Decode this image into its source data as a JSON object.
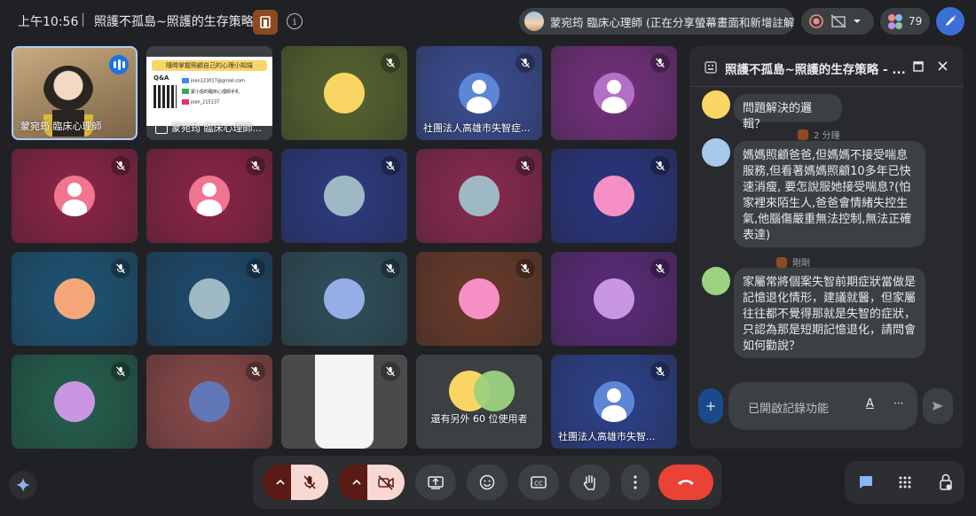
{
  "topbar": {
    "time": "上午10:56",
    "separator": "|",
    "meeting_title": "照護不孤島~照護的生存策略",
    "info_label": "i",
    "presenter_text": "蒙宛筠 臨床心理師 (正在分享螢幕畫面和新增註解)",
    "participant_count": "79"
  },
  "tiles": [
    {
      "name": "蒙宛筠 臨床心理師",
      "kind": "video"
    },
    {
      "name": "蒙宛筠 臨床心理師...",
      "kind": "screen"
    },
    {
      "name": "",
      "kind": "avatar",
      "bg": "#56652f",
      "avatar": "#fbd564"
    },
    {
      "name": "社團法人高雄市失智症...",
      "kind": "person",
      "bg": "#3b4e94",
      "avatar": "#5e86d6"
    },
    {
      "name": "",
      "kind": "person",
      "bg": "#74307e",
      "avatar": "#b46fc7"
    },
    {
      "name": "",
      "kind": "person",
      "bg": "#8c2447",
      "avatar": "#f07591"
    },
    {
      "name": "",
      "kind": "person",
      "bg": "#8c2447",
      "avatar": "#f07591"
    },
    {
      "name": "",
      "kind": "avatar",
      "bg": "#2d3a82",
      "avatar": "#9fb9c4"
    },
    {
      "name": "",
      "kind": "avatar",
      "bg": "#8a2a4f",
      "avatar": "#9fb9c4"
    },
    {
      "name": "",
      "kind": "avatar",
      "bg": "#2b3580",
      "avatar": "#f68fc6"
    },
    {
      "name": "",
      "kind": "avatar",
      "bg": "#1d5576",
      "avatar": "#f6a77a"
    },
    {
      "name": "",
      "kind": "avatar",
      "bg": "#1e4b6e",
      "avatar": "#9fb9c4"
    },
    {
      "name": "",
      "kind": "avatar",
      "bg": "#2f4f5b",
      "avatar": "#95aee6"
    },
    {
      "name": "",
      "kind": "avatar",
      "bg": "#6a3b2a",
      "avatar": "#f68fc6"
    },
    {
      "name": "",
      "kind": "avatar",
      "bg": "#5b2b7a",
      "avatar": "#c896e3"
    },
    {
      "name": "",
      "kind": "avatar",
      "bg": "#24604e",
      "avatar": "#c896e3"
    },
    {
      "name": "",
      "kind": "avatar",
      "bg": "#8c4a4a",
      "avatar": "#5f78b5"
    },
    {
      "name": "",
      "kind": "blurred"
    },
    {
      "name": "還有另外 60 位使用者",
      "kind": "more"
    },
    {
      "name": "社團法人高雄市失智...",
      "kind": "person",
      "bg": "#2d418c",
      "avatar": "#5e86d6"
    }
  ],
  "screen_share": {
    "header": "隨時掌握照顧自己的心理小知識",
    "qa": "Q&A",
    "email": "joan123017@gmail.com",
    "line": "蒙小姐的臨床心理師手札",
    "ig": "joan_215137"
  },
  "chat": {
    "title": "照護不孤島~照護的生存策略 - ...",
    "messages": [
      {
        "meta": "",
        "text": "問題解決的邏輯？",
        "avatar": "#fbd564"
      },
      {
        "meta": "2 分鐘",
        "text": "媽媽照顧爸爸,但媽媽不接受喘息服務,但看著媽媽照顧10多年已快速消瘦, 要怎說服她接受喘息?(怕家裡來陌生人,爸爸會情緒失控生氣,他腦傷嚴重無法控制,無法正確表達)",
        "avatar": "#a8c8ec"
      },
      {
        "meta": "剛剛",
        "text": "家屬常將個案失智前期症狀當做是記憶退化情形，建議就醫，但家屬往往都不覺得那就是失智的症狀，只認為那是短期記憶退化，請問會如何勸說？",
        "avatar": "#9cd27f"
      }
    ],
    "input_placeholder": "已開啟記錄功能",
    "format_label": "A",
    "more_label": "···",
    "add_label": "+"
  },
  "colors": {
    "accent": "#8ab4f8",
    "end_call": "#ea4335",
    "mic_off_bg": "#f7d8d3"
  }
}
